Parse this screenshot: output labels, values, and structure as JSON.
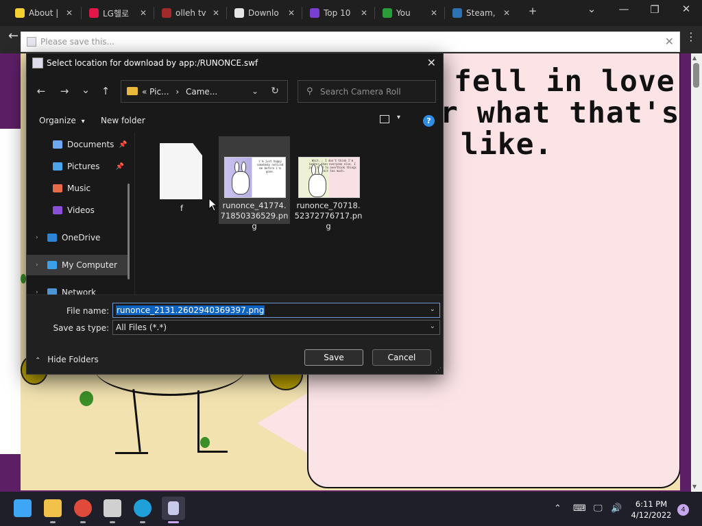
{
  "browser": {
    "tabs": [
      {
        "label": "About |",
        "fav_color": "#f5d033"
      },
      {
        "label": "LG헬로",
        "fav_color": "#e3164a"
      },
      {
        "label": "olleh tv",
        "fav_color": "#a22a2a"
      },
      {
        "label": "Downlo",
        "fav_color": "#e6e6e6"
      },
      {
        "label": "Top 10",
        "fav_color": "#7a3fd1"
      },
      {
        "label": "You",
        "fav_color": "#2a9d3a"
      },
      {
        "label": "Steam,",
        "fav_color": "#2d73b4"
      }
    ],
    "new_tab_glyph": "+",
    "window_controls": {
      "dropdown": "⌄",
      "minimize": "—",
      "restore": "❐",
      "close": "✕"
    },
    "back_glyph": "←",
    "menu_glyph": "⋮"
  },
  "host_window": {
    "title": "Please save this...",
    "close_glyph": "✕"
  },
  "story": {
    "line1": "fell in love. I",
    "line2": "r what that's",
    "line3": "like."
  },
  "dialog": {
    "title": "Select location for download by app:/RUNONCE.swf",
    "close_glyph": "✕",
    "nav": {
      "back": "←",
      "forward": "→",
      "recent": "⌄",
      "up": "↑"
    },
    "address": {
      "prefix": "«",
      "crumb1": "Pic...",
      "sep": "›",
      "crumb2": "Came...",
      "dropdown": "⌄",
      "refresh": "↻"
    },
    "search": {
      "placeholder": "Search Camera Roll",
      "icon": "⚲"
    },
    "commands": {
      "organize": "Organize",
      "organize_caret": "▾",
      "new_folder": "New folder",
      "view_caret": "▾",
      "help": "?"
    },
    "nav_pane": [
      {
        "label": "Documents",
        "pinned": true,
        "icon_color": "#6ea8f0",
        "expandable": false,
        "selected": false
      },
      {
        "label": "Pictures",
        "pinned": true,
        "icon_color": "#4fa3e8",
        "expandable": false,
        "selected": false
      },
      {
        "label": "Music",
        "pinned": false,
        "icon_color": "#e86a4a",
        "expandable": false,
        "selected": false
      },
      {
        "label": "Videos",
        "pinned": false,
        "icon_color": "#8a4fd8",
        "expandable": false,
        "selected": false
      },
      {
        "label": "OneDrive",
        "pinned": false,
        "icon_color": "#2b84d6",
        "expandable": true,
        "selected": false
      },
      {
        "label": "My Computer",
        "pinned": false,
        "icon_color": "#3ca0e6",
        "expandable": true,
        "selected": true
      },
      {
        "label": "Network",
        "pinned": false,
        "icon_color": "#4f95d6",
        "expandable": true,
        "selected": false
      }
    ],
    "pin_glyph": "📌",
    "expand_glyph": "›",
    "files": [
      {
        "name": "f",
        "kind": "blank",
        "selected": false
      },
      {
        "name": "runonce_41774.71850336529.png",
        "kind": "image",
        "selected": true,
        "caption": "i'm just happy somebody noticed me before i'm gone."
      },
      {
        "name": "runonce_70718.52372776717.png",
        "kind": "image",
        "selected": false,
        "caption": "Wait... I don't think I'm better than everyone else. I just tend to overthink things a bit too much."
      }
    ],
    "file_name_label": "File name:",
    "file_name_value": "runonce_2131.2602940369397.png",
    "save_type_label": "Save as type:",
    "save_type_value": "All Files (*.*)",
    "hide_folders": "Hide Folders",
    "hide_folders_caret": "⌃",
    "save_button": "Save",
    "cancel_button": "Cancel"
  },
  "taskbar": {
    "apps": [
      {
        "name": "start",
        "color": "#3fa6f5"
      },
      {
        "name": "file-explorer",
        "color": "#f2c14a"
      },
      {
        "name": "chrome",
        "color": "#e04a3a"
      },
      {
        "name": "flash-app",
        "color": "#d0d0d0"
      },
      {
        "name": "edge",
        "color": "#1fa0d8"
      },
      {
        "name": "runonce",
        "color": "#c9c9e8"
      }
    ],
    "tray": {
      "chevron": "⌃",
      "keyboard": "⌨",
      "network": "🖵",
      "volume": "🔊"
    },
    "time": "6:11 PM",
    "date": "4/12/2022",
    "notifications": "4"
  }
}
